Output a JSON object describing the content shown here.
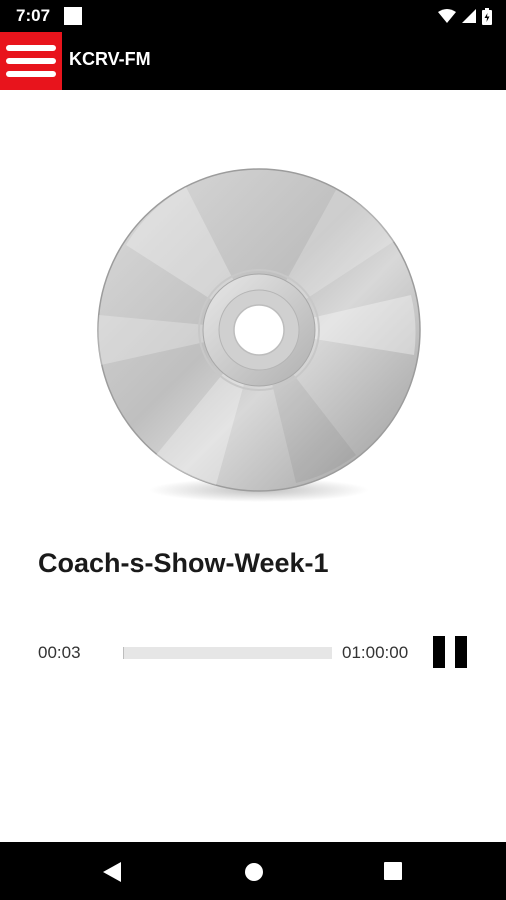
{
  "status_bar": {
    "time": "7:07"
  },
  "app_bar": {
    "title": "KCRV-FM"
  },
  "player": {
    "track_title": "Coach-s-Show-Week-1",
    "current_time": "00:03",
    "total_time": "01:00:00",
    "progress_fraction": 0.0008
  },
  "colors": {
    "accent": "#e8141c",
    "bar_background": "#000000"
  },
  "icons": {
    "menu": "hamburger-menu-icon",
    "pause": "pause-icon",
    "disc": "compact-disc-icon",
    "nav_back": "back-triangle-icon",
    "nav_home": "home-circle-icon",
    "nav_recents": "recents-square-icon"
  }
}
